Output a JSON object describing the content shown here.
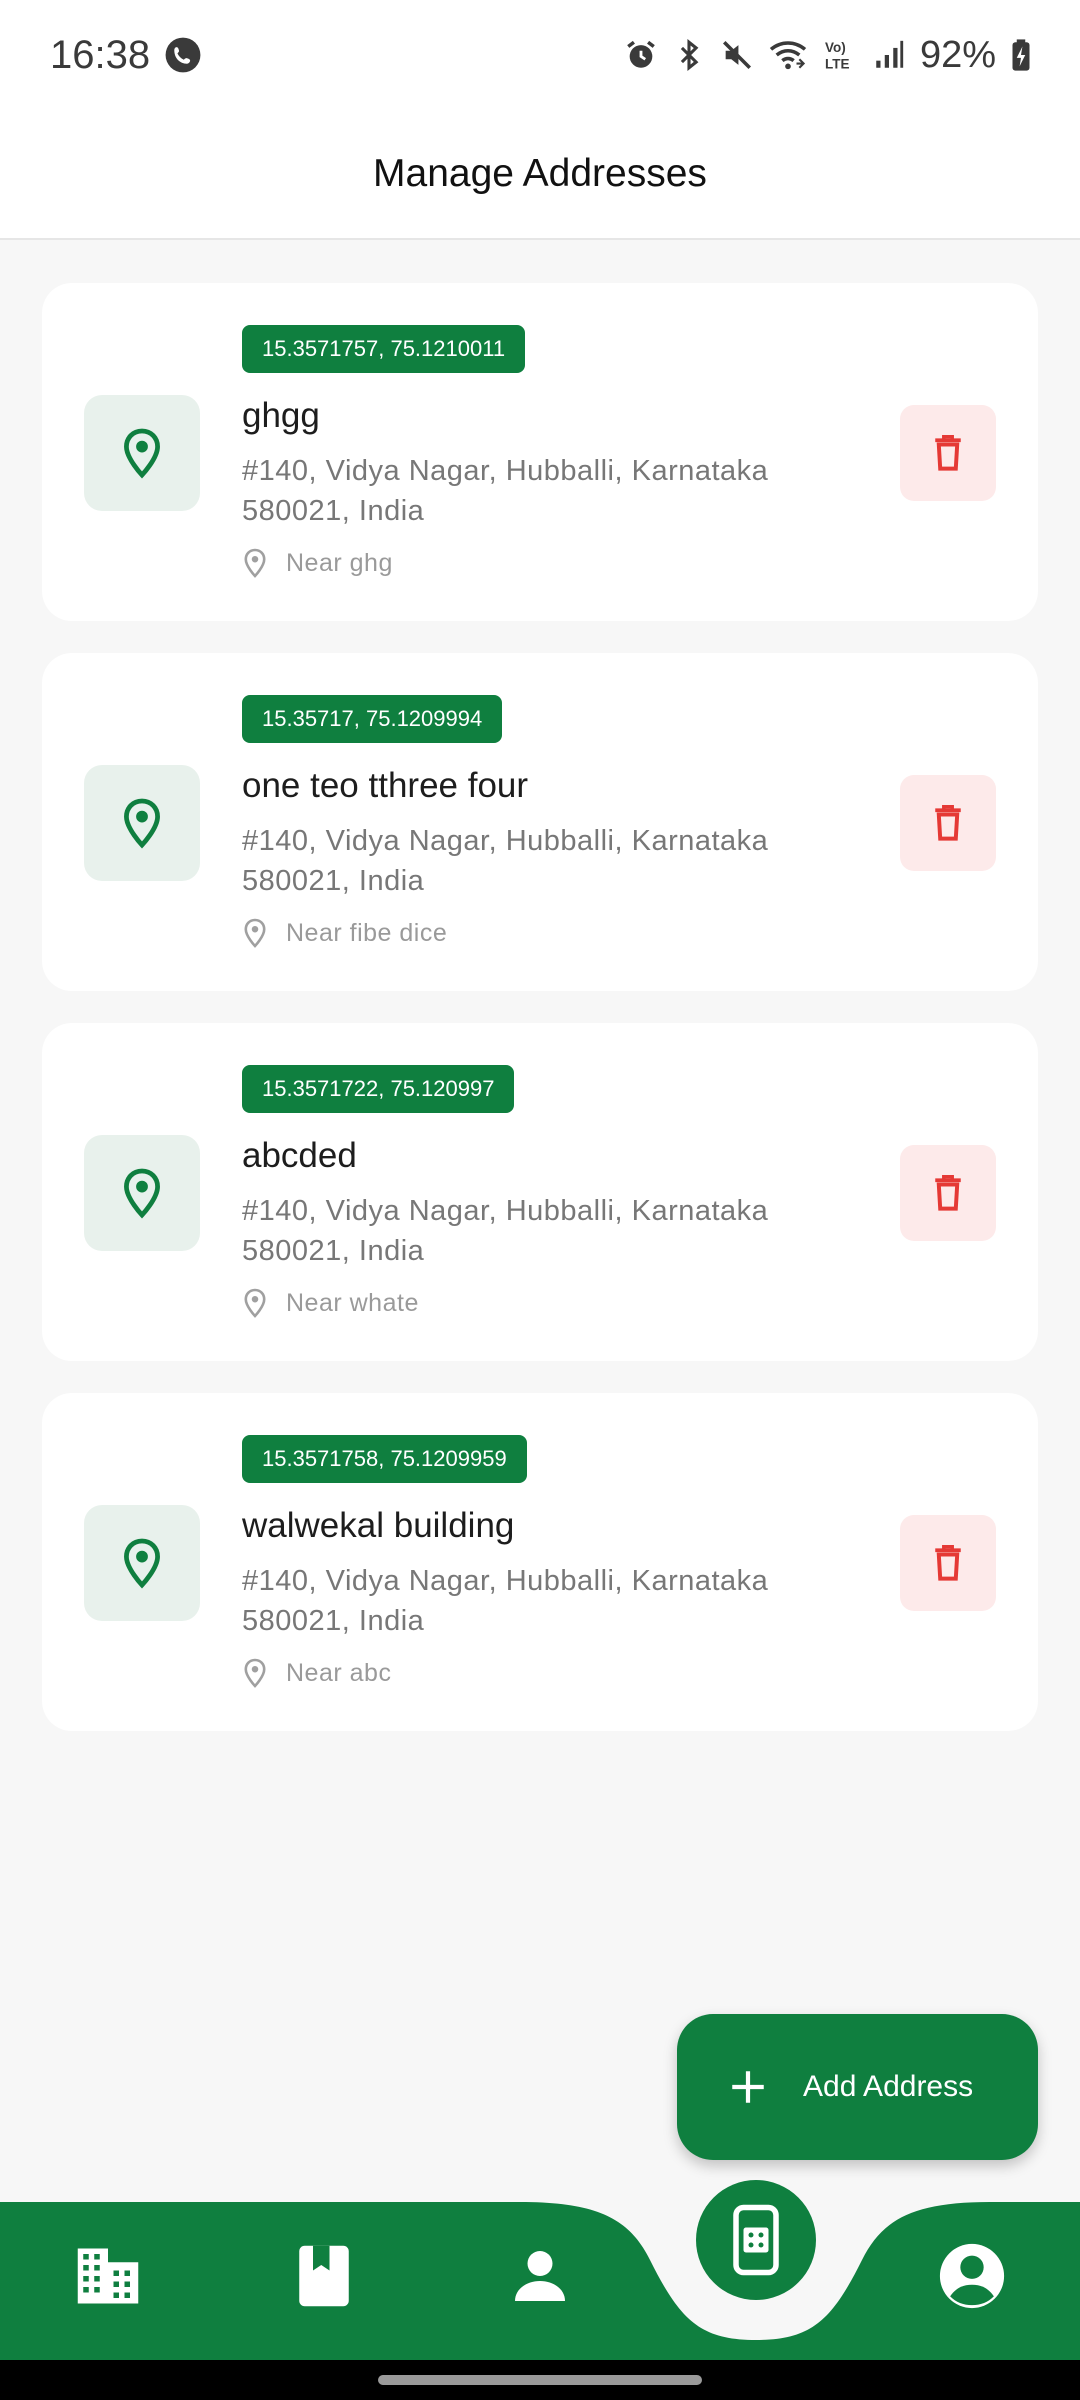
{
  "status_bar": {
    "time": "16:38",
    "battery": "92%",
    "icons": [
      "whatsapp-call-icon",
      "alarm-icon",
      "bluetooth-icon",
      "mute-icon",
      "wifi-icon",
      "volte-icon",
      "signal-icon",
      "battery-charging-icon"
    ]
  },
  "app_bar": {
    "title": "Manage Addresses"
  },
  "addresses": [
    {
      "coords": "15.3571757, 75.1210011",
      "name": "ghgg",
      "address_line1": "#140, Vidya Nagar, Hubballi, Karnataka",
      "address_line2": "580021, India",
      "landmark": "Near ghg"
    },
    {
      "coords": "15.35717, 75.1209994",
      "name": "one teo tthree four",
      "address_line1": "#140, Vidya Nagar, Hubballi, Karnataka",
      "address_line2": "580021, India",
      "landmark": "Near fibe dice"
    },
    {
      "coords": "15.3571722, 75.120997",
      "name": "abcded",
      "address_line1": "#140, Vidya Nagar, Hubballi, Karnataka",
      "address_line2": "580021, India",
      "landmark": "Near whate"
    },
    {
      "coords": "15.3571758, 75.1209959",
      "name": "walwekal building",
      "address_line1": "#140, Vidya Nagar, Hubballi, Karnataka",
      "address_line2": "580021, India",
      "landmark": "Near abc"
    }
  ],
  "fab": {
    "label": "Add Address",
    "icon": "plus-icon"
  },
  "bottom_nav": {
    "items": [
      "building-icon",
      "bookmark-book-icon",
      "person-icon",
      "address-card-icon",
      "account-circle-icon"
    ],
    "active": "address-card-icon"
  },
  "colors": {
    "primary": "#0f7f3f",
    "pin_bg": "#e8f1ec",
    "delete_bg": "#fdeaea",
    "delete_icon": "#e53935"
  }
}
